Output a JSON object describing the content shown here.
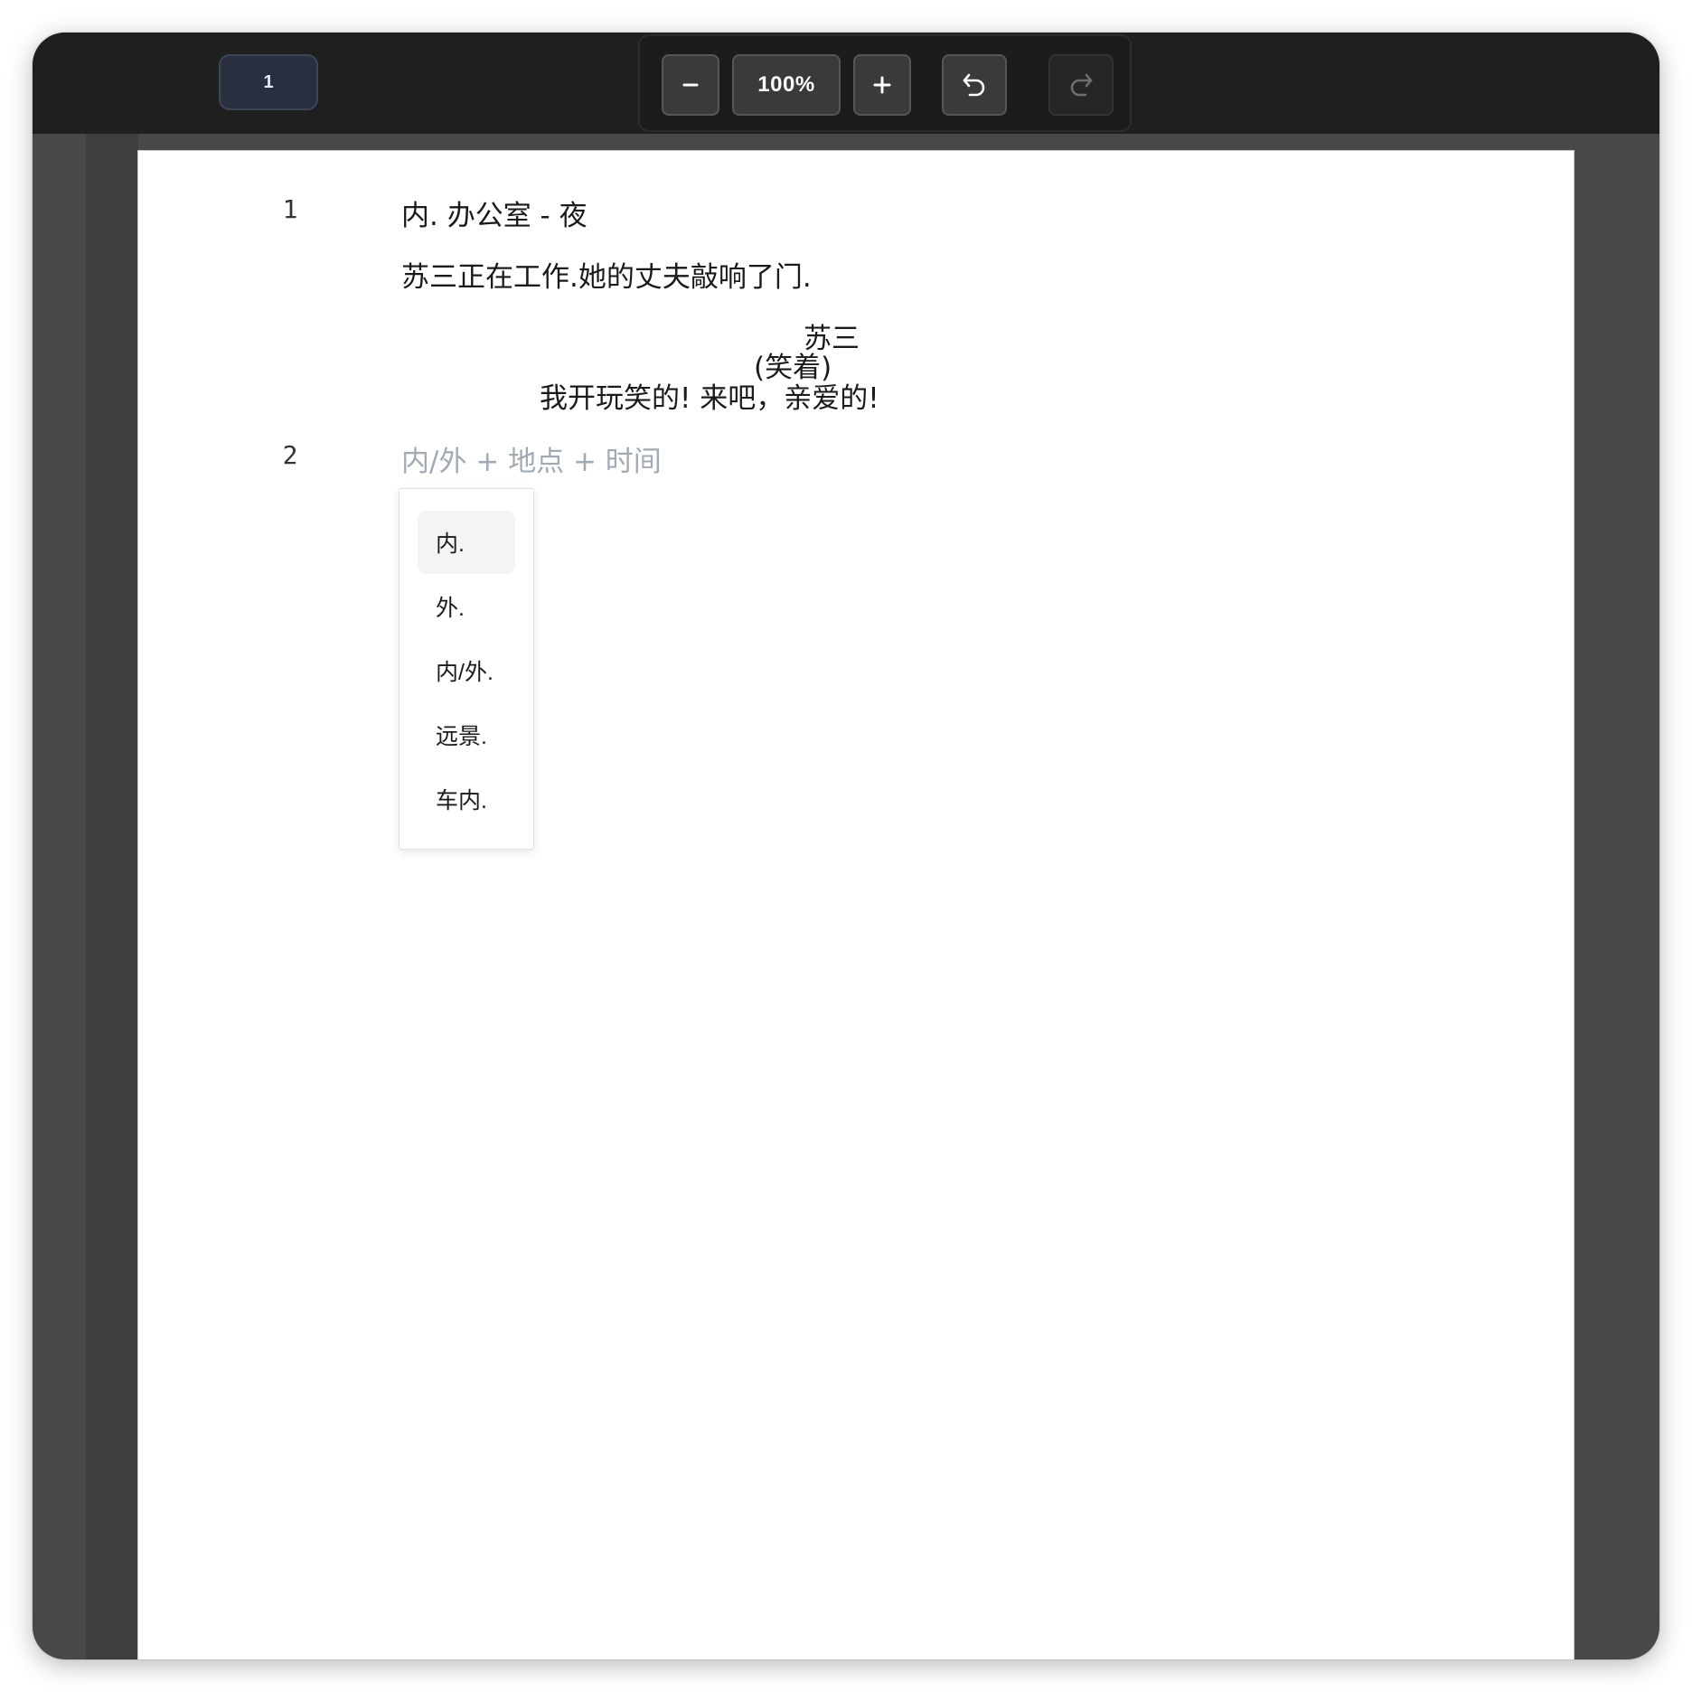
{
  "toolbar": {
    "page_number": "1",
    "zoom_level": "100%",
    "zoom_out_icon": "minus-icon",
    "zoom_in_icon": "plus-icon",
    "undo_icon": "undo-icon",
    "redo_icon": "redo-icon",
    "redo_enabled": false
  },
  "script": {
    "scene1": {
      "number": "1",
      "heading": "内. 办公室 - 夜",
      "action": "苏三正在工作.她的丈夫敲响了门.",
      "character": "苏三",
      "parenthetical": "(笑着)",
      "dialogue": "我开玩笑的! 来吧，亲爱的!"
    },
    "scene2": {
      "number": "2",
      "heading_placeholder": "内/外 + 地点 + 时间"
    }
  },
  "dropdown": {
    "items": [
      {
        "label": "内.",
        "highlighted": true
      },
      {
        "label": "外.",
        "highlighted": false
      },
      {
        "label": "内/外.",
        "highlighted": false
      },
      {
        "label": "远景.",
        "highlighted": false
      },
      {
        "label": "车内.",
        "highlighted": false
      }
    ]
  },
  "colors": {
    "toolbar_bg": "#1f1f1f",
    "canvas_bg": "#484848",
    "page_bg": "#ffffff",
    "placeholder_text": "#a1a9b5",
    "page_indicator_bg": "#283040"
  }
}
